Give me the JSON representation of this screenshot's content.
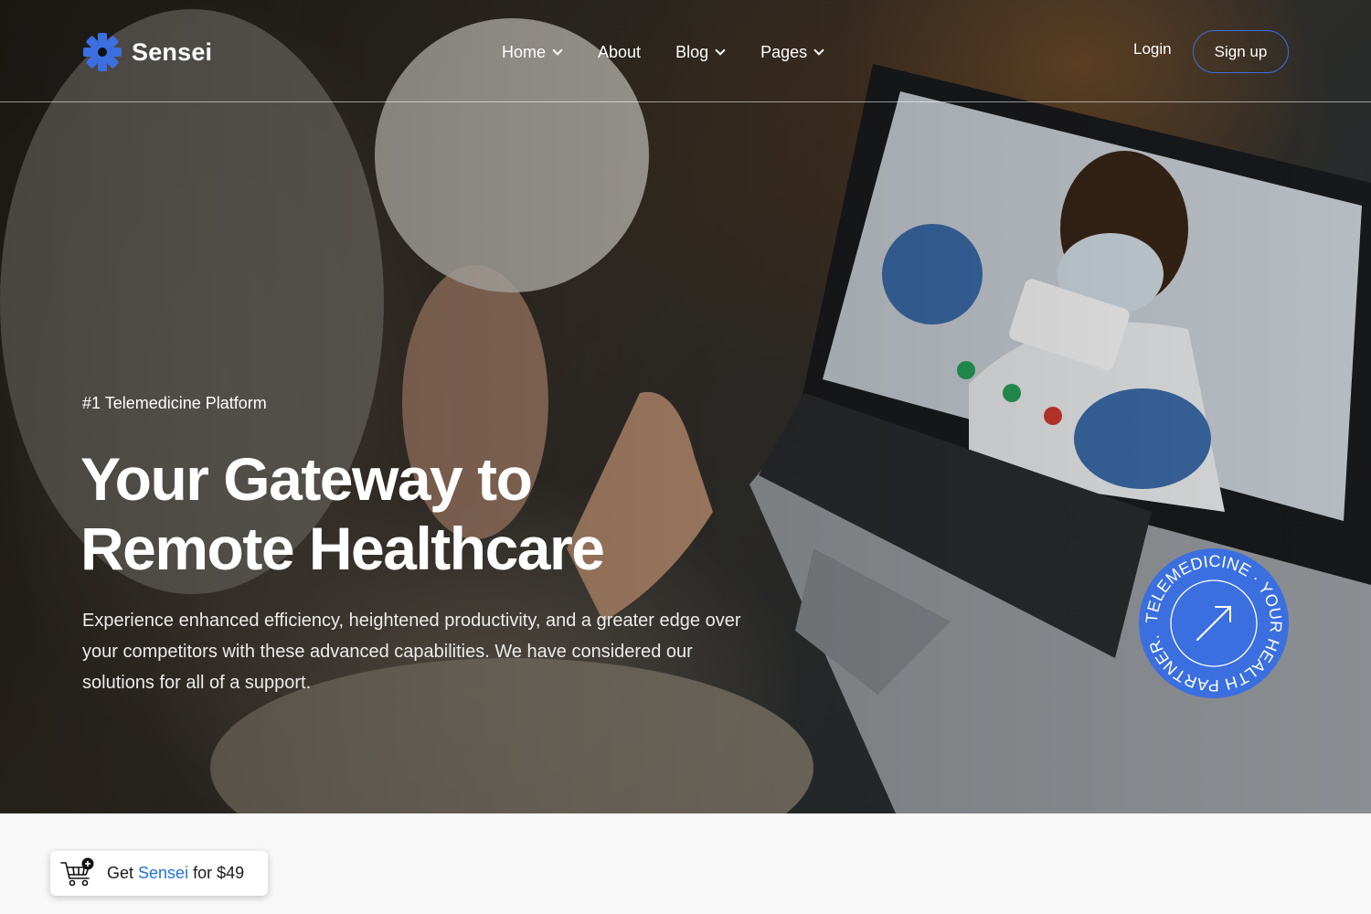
{
  "brand": {
    "name": "Sensei",
    "logo_icon": "gear-icon",
    "accent_color": "#3b6fe0"
  },
  "nav": {
    "items": [
      {
        "label": "Home",
        "has_dropdown": true
      },
      {
        "label": "About",
        "has_dropdown": false
      },
      {
        "label": "Blog",
        "has_dropdown": true
      },
      {
        "label": "Pages",
        "has_dropdown": true
      }
    ],
    "login_label": "Login",
    "signup_label": "Sign up"
  },
  "hero": {
    "eyebrow": "#1 Telemedicine Platform",
    "headline_line1": "Your Gateway to",
    "headline_line2": "Remote Healthcare",
    "lead": "Experience enhanced efficiency, heightened productivity, and a greater edge over your competitors with these advanced capabilities. We have considered our solutions for all of a support.",
    "badge_text": "TELEMEDICINE · YOUR HEALTH PARTNER.",
    "badge_icon": "arrow-up-right-icon",
    "badge_color": "#3b6fe0"
  },
  "buy_widget": {
    "icon": "cart-plus-icon",
    "prefix": "Get",
    "brand": "Sensei",
    "suffix": "for $49"
  }
}
